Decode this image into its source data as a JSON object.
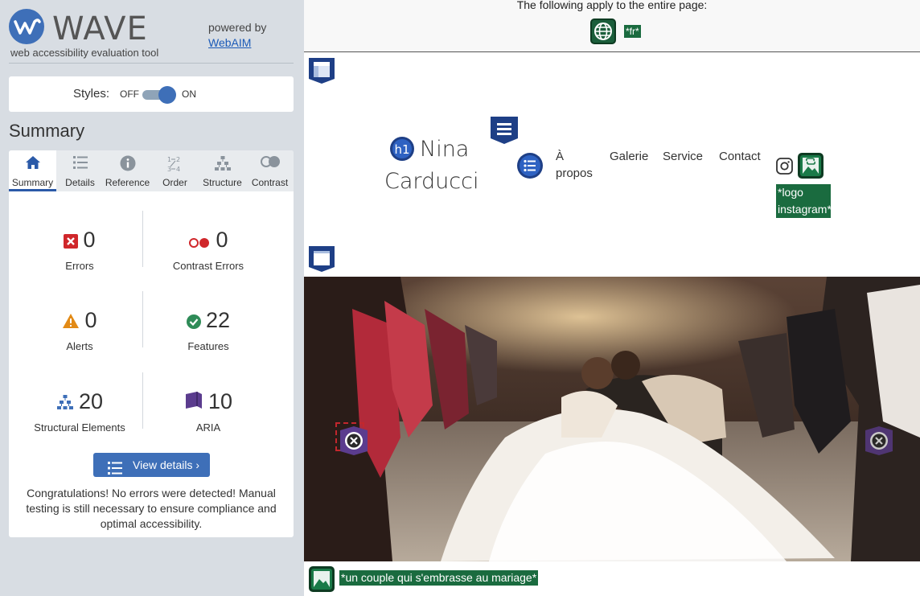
{
  "wave": {
    "brand": "WAVE",
    "tagline": "web accessibility evaluation tool",
    "powered_by": "powered by",
    "webaim_link": "WebAIM",
    "styles_label": "Styles:",
    "toggle_off": "OFF",
    "toggle_on": "ON",
    "summary_title": "Summary",
    "tabs": [
      {
        "label": "Summary",
        "icon": "home-icon"
      },
      {
        "label": "Details",
        "icon": "list-icon"
      },
      {
        "label": "Reference",
        "icon": "info-icon"
      },
      {
        "label": "Order",
        "icon": "order-icon"
      },
      {
        "label": "Structure",
        "icon": "structure-icon"
      },
      {
        "label": "Contrast",
        "icon": "contrast-icon"
      }
    ],
    "stats": {
      "errors": {
        "value": "0",
        "label": "Errors"
      },
      "contrast_errors": {
        "value": "0",
        "label": "Contrast Errors"
      },
      "alerts": {
        "value": "0",
        "label": "Alerts"
      },
      "features": {
        "value": "22",
        "label": "Features"
      },
      "structural": {
        "value": "20",
        "label": "Structural Elements"
      },
      "aria": {
        "value": "10",
        "label": "ARIA"
      }
    },
    "view_details": "View details ›",
    "congrats": "Congratulations! No errors were detected! Manual testing is still necessary to ensure compliance and optimal accessibility.",
    "colors": {
      "accent": "#3e6fb8",
      "error": "#d0272b",
      "alert": "#e28a16",
      "feature": "#2e8b57",
      "aria": "#5b3c8e"
    }
  },
  "page": {
    "entire_page_note": "The following apply to the entire page:",
    "lang_tag": "*fr*",
    "h1_badge": "h1",
    "site_title_line1": "Nina",
    "site_title_line2": "Carducci",
    "nav": {
      "about_line1": "À",
      "about_line2": "propos",
      "gallery": "Galerie",
      "service": "Service",
      "contact": "Contact"
    },
    "instagram_alt_line1": "*logo",
    "instagram_alt_line2": "instagram*",
    "hero_alt": "*un couple qui s'embrasse au mariage*"
  }
}
